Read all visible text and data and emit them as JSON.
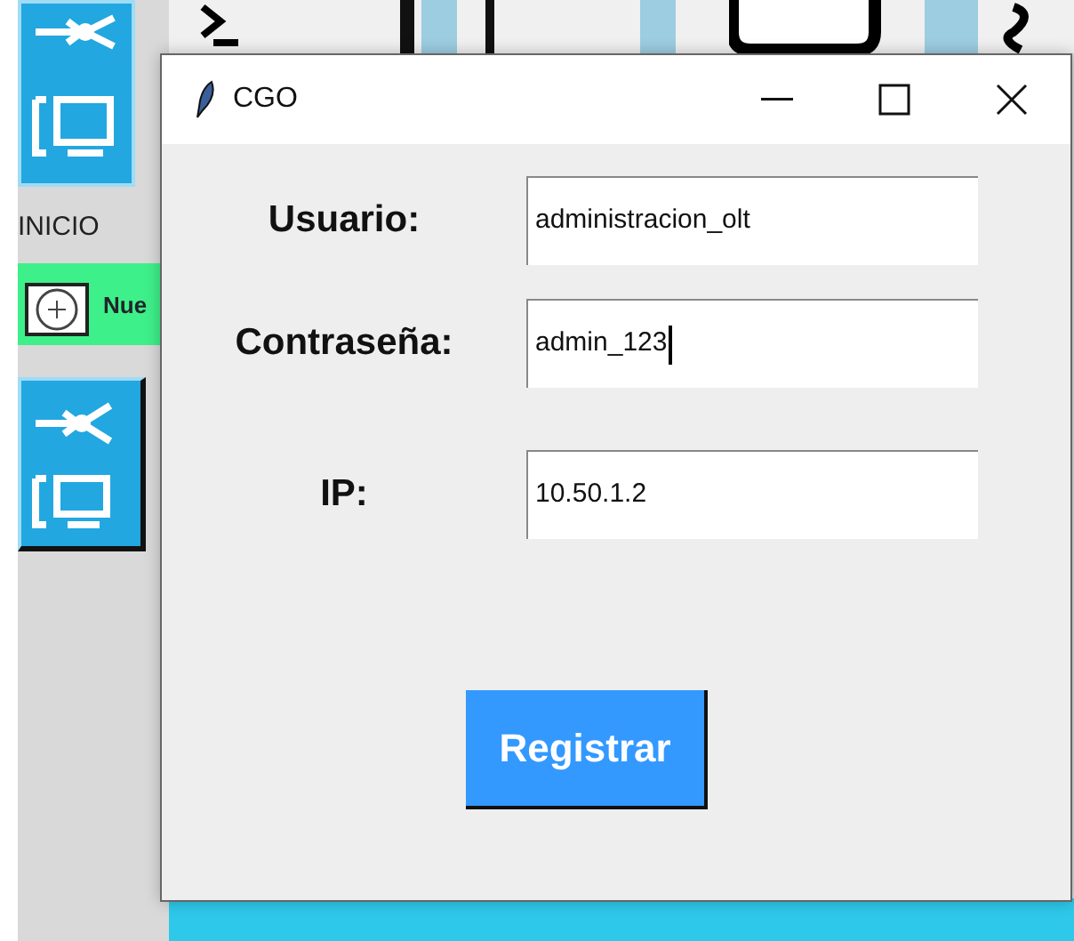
{
  "background_app": {
    "side_label": "INICIO",
    "new_button": "Nue"
  },
  "dialog": {
    "title": "CGO",
    "fields": [
      {
        "label": "Usuario:",
        "value": "administracion_olt",
        "focused": false
      },
      {
        "label": "Contraseña:",
        "value": "admin_123",
        "focused": true
      },
      {
        "label": "IP:",
        "value": "10.50.1.2",
        "focused": false
      }
    ],
    "button": "Registrar"
  }
}
